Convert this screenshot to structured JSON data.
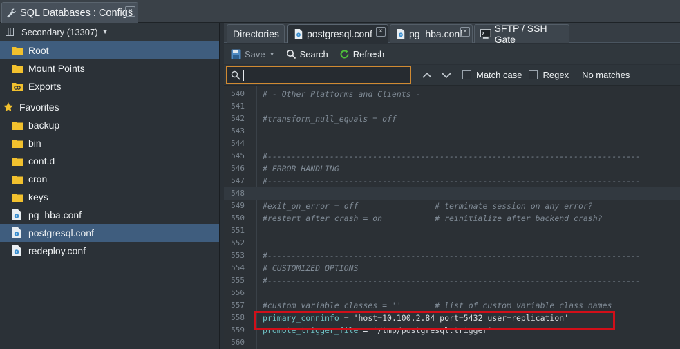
{
  "window": {
    "title": "SQL Databases : Configs",
    "close_glyph": "×",
    "icon": "wrench-icon"
  },
  "account": {
    "label": "Secondary (13307)",
    "icon": "server-icon",
    "caret": "▼"
  },
  "tree": {
    "roots": [
      {
        "label": "Root",
        "icon": "folder-icon",
        "selected": true
      },
      {
        "label": "Mount Points",
        "icon": "folder-icon"
      },
      {
        "label": "Exports",
        "icon": "link-icon"
      }
    ],
    "favorites_label": "Favorites",
    "favorites": [
      {
        "label": "backup",
        "icon": "folder-icon"
      },
      {
        "label": "bin",
        "icon": "folder-icon"
      },
      {
        "label": "conf.d",
        "icon": "folder-icon"
      },
      {
        "label": "cron",
        "icon": "folder-icon"
      },
      {
        "label": "keys",
        "icon": "folder-icon"
      },
      {
        "label": "pg_hba.conf",
        "icon": "config-file-icon"
      },
      {
        "label": "postgresql.conf",
        "icon": "config-file-icon",
        "selected": true
      },
      {
        "label": "redeploy.conf",
        "icon": "config-file-icon"
      }
    ]
  },
  "tabs": [
    {
      "label": "Directories"
    },
    {
      "label": "postgresql.conf",
      "active": true,
      "close": "×"
    },
    {
      "label": "pg_hba.conf",
      "close": "×"
    },
    {
      "label": "SFTP / SSH Gate"
    }
  ],
  "toolbar": {
    "save": "Save",
    "search": "Search",
    "refresh": "Refresh"
  },
  "find": {
    "value": "",
    "placeholder": "",
    "match_case": "Match case",
    "regex": "Regex",
    "status": "No matches"
  },
  "editor": {
    "lines": [
      {
        "n": "540",
        "text": "# - Other Platforms and Clients -"
      },
      {
        "n": "541",
        "text": ""
      },
      {
        "n": "542",
        "text": "#transform_null_equals = off"
      },
      {
        "n": "543",
        "text": ""
      },
      {
        "n": "544",
        "text": ""
      },
      {
        "n": "545",
        "text": "#------------------------------------------------------------------------------"
      },
      {
        "n": "546",
        "text": "# ERROR HANDLING"
      },
      {
        "n": "547",
        "text": "#------------------------------------------------------------------------------"
      },
      {
        "n": "548",
        "text": "",
        "current": true
      },
      {
        "n": "549",
        "text": "#exit_on_error = off                # terminate session on any error?"
      },
      {
        "n": "550",
        "text": "#restart_after_crash = on           # reinitialize after backend crash?"
      },
      {
        "n": "551",
        "text": ""
      },
      {
        "n": "552",
        "text": ""
      },
      {
        "n": "553",
        "text": "#------------------------------------------------------------------------------"
      },
      {
        "n": "554",
        "text": "# CUSTOMIZED OPTIONS"
      },
      {
        "n": "555",
        "text": "#------------------------------------------------------------------------------"
      },
      {
        "n": "556",
        "text": ""
      },
      {
        "n": "557",
        "text": "#custom_variable_classes = ''       # list of custom variable class names"
      },
      {
        "n": "558",
        "key": "primary_conninfo",
        "op": " = ",
        "value": "'host=10.100.2.84 port=5432 user=replication'",
        "highlighted": true
      },
      {
        "n": "559",
        "key": "promote_trigger_file",
        "op": " = ",
        "value": "'/tmp/postgresql.trigger'"
      },
      {
        "n": "560",
        "text": ""
      }
    ]
  },
  "colors": {
    "selection": "#3f5d7e",
    "highlight_border": "#d10f19",
    "find_border": "#d08a32",
    "key": "#6fc1c4"
  }
}
